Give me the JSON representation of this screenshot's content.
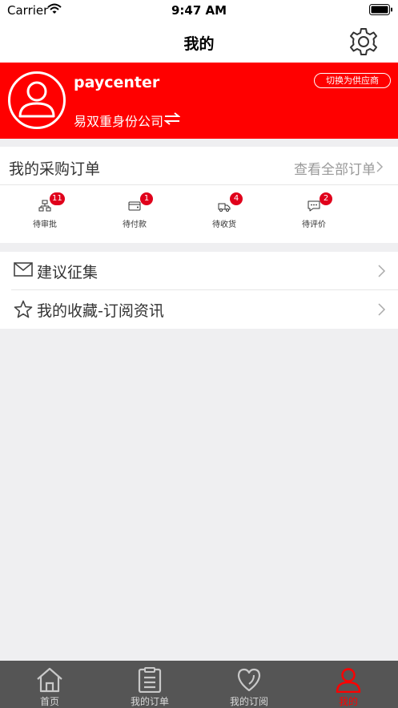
{
  "status_bar": {
    "carrier": "Carrier",
    "time": "9:47 AM"
  },
  "nav": {
    "title": "我的",
    "settings_icon": "gear-icon"
  },
  "profile": {
    "username": "paycenter",
    "switch_label": "切换为供应商",
    "company": "易双重身份公司",
    "avatar_icon": "user-icon"
  },
  "orders": {
    "title": "我的采购订单",
    "view_all": "查看全部订单",
    "items": [
      {
        "label": "待审批",
        "badge": "11",
        "icon": "approval-icon"
      },
      {
        "label": "待付款",
        "badge": "1",
        "icon": "wallet-icon"
      },
      {
        "label": "待收货",
        "badge": "4",
        "icon": "truck-icon"
      },
      {
        "label": "待评价",
        "badge": "2",
        "icon": "comment-icon"
      }
    ]
  },
  "menu": [
    {
      "label": "建议征集",
      "icon": "mail-icon"
    },
    {
      "label": "我的收藏-订阅资讯",
      "icon": "star-icon"
    }
  ],
  "tabs": [
    {
      "label": "首页",
      "icon": "home-icon",
      "active": false
    },
    {
      "label": "我的订单",
      "icon": "clipboard-icon",
      "active": false
    },
    {
      "label": "我的订阅",
      "icon": "heart-icon",
      "active": false
    },
    {
      "label": "我的",
      "icon": "user-icon",
      "active": true
    }
  ],
  "colors": {
    "accent": "#ff0000",
    "badge": "#e0001b",
    "tabbar": "#555555"
  }
}
